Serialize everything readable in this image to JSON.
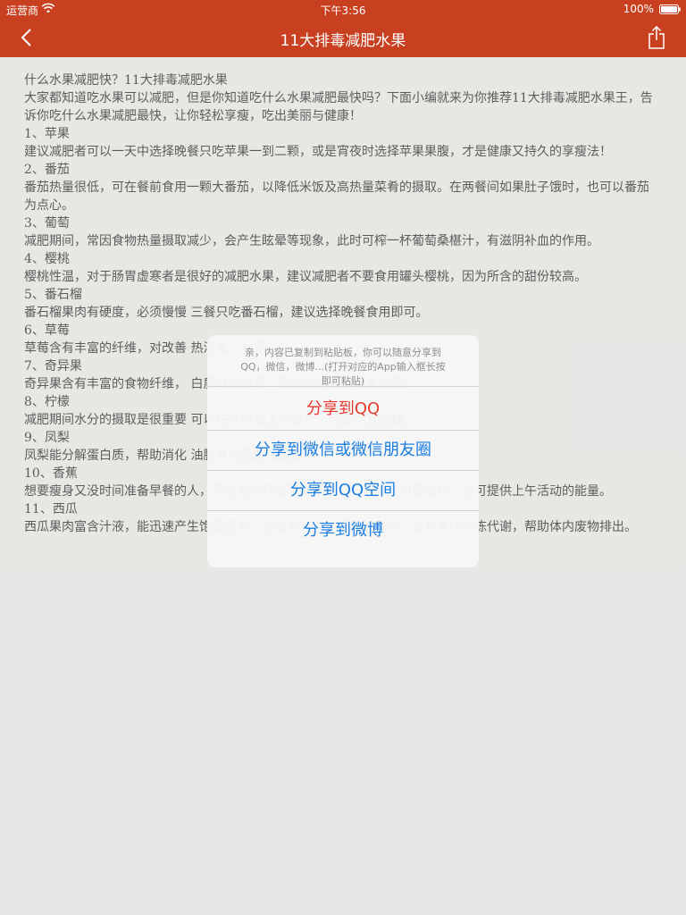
{
  "status_bar": {
    "carrier": "运营商",
    "time": "下午3:56",
    "battery": "100%"
  },
  "nav": {
    "title": "11大排毒减肥水果",
    "back_icon": "chevron-left-icon",
    "share_icon": "share-icon"
  },
  "theme": {
    "nav_color": "#c84020",
    "action_color": "#1a7de0",
    "first_action_color": "#e63a2e"
  },
  "article": {
    "paragraphs": [
      "什么水果减肥快？11大排毒减肥水果",
      "大家都知道吃水果可以减肥，但是你知道吃什么水果减肥最快吗？下面小编就来为你推荐11大排毒减肥水果王，告诉你吃什么水果减肥最快，让你轻松享瘦，吃出美丽与健康！",
      "1、苹果",
      "建议减肥者可以一天中选择晚餐只吃苹果一到二颗，或是宵夜时选择苹果果腹，才是健康又持久的享瘦法！",
      "2、番茄",
      "番茄热量很低，可在餐前食用一颗大番茄，以降低米饭及高热量菜肴的摄取。在两餐间如果肚子饿时，也可以番茄为点心。",
      "3、葡萄",
      "减肥期间，常因食物热量摄取减少，会产生眩晕等现象，此时可榨一杯葡萄桑椹汁，有滋阴补血的作用。",
      "4、樱桃",
      "樱桃性温，对于肠胃虚寒者是很好的减肥水果，建议减肥者不要食用罐头樱桃，因为所含的甜份较高。",
      "5、番石榴",
      "番石榴果肉有硬度，必须慢慢                                   三餐只吃番石榴，建议选择晚餐食用即可。",
      "6、草莓",
      "草莓含有丰富的纤维，对改善                                   热消暑、利尿。",
      "7、奇异果",
      "奇异果含有丰富的食物纤维，                                   白质分解酵素，因此很适合与肉类搭配。",
      "8、柠檬",
      "减肥期间水分的摄取是很重要                                   可以在水中加上柠檬片，但是不宜加糖。",
      "9、凤梨",
      "凤梨能分解蛋白质，帮助消化                                   油腻食物后的油腻感。",
      "10、香蕉",
      "想要瘦身又没时间准备早餐的人，可以喝一杯香蕉牛奶汁，不但可使排便顺畅，也可提供上午活动的能量。",
      "11、西瓜",
      "西瓜果肉富含汁液，能迅速产生饱足感外，亦能补充人体流失的水份，有利身体新陈代谢，帮助体内废物排出。"
    ]
  },
  "dialog": {
    "message": [
      "亲，内容已复制到粘贴板，你可以随意分享到",
      "QQ，微信，微博...(打开对应的App输入框长按",
      "即可粘贴)"
    ],
    "actions": [
      "分享到QQ",
      "分享到微信或微信朋友圈",
      "分享到QQ空间",
      "分享到微博"
    ]
  }
}
